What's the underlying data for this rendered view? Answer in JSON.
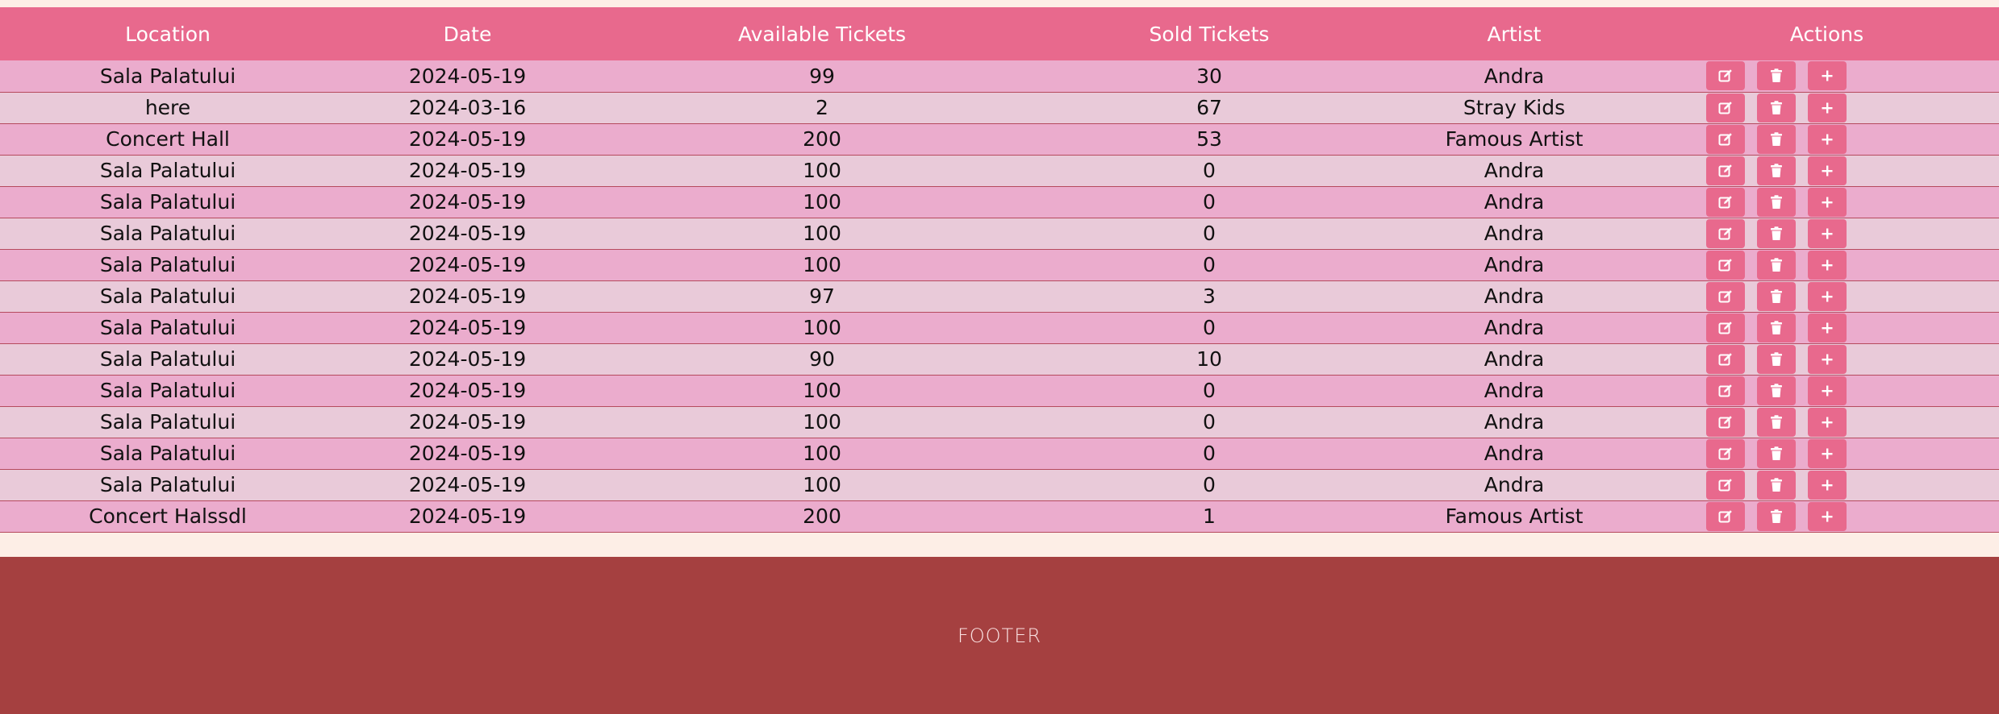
{
  "table": {
    "headers": [
      "Location",
      "Date",
      "Available Tickets",
      "Sold Tickets",
      "Artist",
      "Actions"
    ],
    "rows": [
      {
        "location": "Sala Palatului",
        "date": "2024-05-19",
        "available": "99",
        "sold": "30",
        "artist": "Andra"
      },
      {
        "location": "here",
        "date": "2024-03-16",
        "available": "2",
        "sold": "67",
        "artist": "Stray Kids"
      },
      {
        "location": "Concert Hall",
        "date": "2024-05-19",
        "available": "200",
        "sold": "53",
        "artist": "Famous Artist"
      },
      {
        "location": "Sala Palatului",
        "date": "2024-05-19",
        "available": "100",
        "sold": "0",
        "artist": "Andra"
      },
      {
        "location": "Sala Palatului",
        "date": "2024-05-19",
        "available": "100",
        "sold": "0",
        "artist": "Andra"
      },
      {
        "location": "Sala Palatului",
        "date": "2024-05-19",
        "available": "100",
        "sold": "0",
        "artist": "Andra"
      },
      {
        "location": "Sala Palatului",
        "date": "2024-05-19",
        "available": "100",
        "sold": "0",
        "artist": "Andra"
      },
      {
        "location": "Sala Palatului",
        "date": "2024-05-19",
        "available": "97",
        "sold": "3",
        "artist": "Andra"
      },
      {
        "location": "Sala Palatului",
        "date": "2024-05-19",
        "available": "100",
        "sold": "0",
        "artist": "Andra"
      },
      {
        "location": "Sala Palatului",
        "date": "2024-05-19",
        "available": "90",
        "sold": "10",
        "artist": "Andra"
      },
      {
        "location": "Sala Palatului",
        "date": "2024-05-19",
        "available": "100",
        "sold": "0",
        "artist": "Andra"
      },
      {
        "location": "Sala Palatului",
        "date": "2024-05-19",
        "available": "100",
        "sold": "0",
        "artist": "Andra"
      },
      {
        "location": "Sala Palatului",
        "date": "2024-05-19",
        "available": "100",
        "sold": "0",
        "artist": "Andra"
      },
      {
        "location": "Sala Palatului",
        "date": "2024-05-19",
        "available": "100",
        "sold": "0",
        "artist": "Andra"
      },
      {
        "location": "Concert Halssdl",
        "date": "2024-05-19",
        "available": "200",
        "sold": "1",
        "artist": "Famous Artist"
      }
    ],
    "action_icons": [
      "edit-icon",
      "trash-icon",
      "plus-icon"
    ]
  },
  "footer": {
    "text": "FOOTER"
  },
  "colors": {
    "header_bg": "#e8698d",
    "row_odd": "#ebaccd",
    "row_even": "#e9cad9",
    "action_button": "#e8698d",
    "footer_bg": "#a54040",
    "page_bg": "#fdeee6"
  }
}
